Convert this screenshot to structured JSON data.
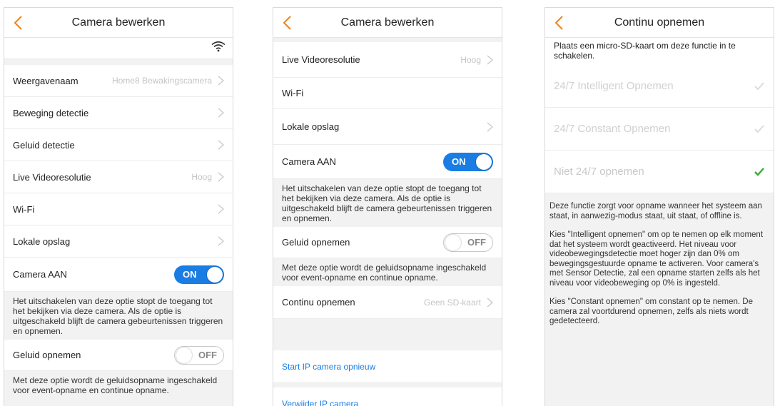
{
  "colors": {
    "accent_orange": "#f0811a",
    "blue": "#1a7de3",
    "check_green": "#3aa83a"
  },
  "screen1": {
    "title": "Camera bewerken",
    "rows": [
      {
        "label": "Weergavenaam",
        "value": "Home8 Bewakingscamera"
      },
      {
        "label": "Beweging detectie",
        "value": ""
      },
      {
        "label": "Geluid detectie",
        "value": ""
      },
      {
        "label": "Live Videoresolutie",
        "value": "Hoog"
      },
      {
        "label": "Wi-Fi",
        "value": ""
      },
      {
        "label": "Lokale opslag",
        "value": ""
      }
    ],
    "camera_on": {
      "label": "Camera AAN",
      "state": "ON"
    },
    "camera_note": "Het uitschakelen van deze optie stopt de toegang tot het bekijken via deze camera. Als de optie is uitgeschakeld blijft de camera gebeurtenissen triggeren en opnemen.",
    "audio": {
      "label": "Geluid opnemen",
      "state": "OFF"
    },
    "audio_note": "Met deze optie wordt de geluidsopname ingeschakeld voor event-opname en continue opname."
  },
  "screen2": {
    "title": "Camera bewerken",
    "rows": [
      {
        "label": "Live Videoresolutie",
        "value": "Hoog"
      },
      {
        "label": "Wi-Fi",
        "value": ""
      },
      {
        "label": "Lokale opslag",
        "value": ""
      }
    ],
    "camera_on": {
      "label": "Camera AAN",
      "state": "ON"
    },
    "camera_note": "Het uitschakelen van deze optie stopt de toegang tot het bekijken via deze camera. Als de optie is uitgeschakeld blijft de camera gebeurtenissen triggeren en opnemen.",
    "audio": {
      "label": "Geluid opnemen",
      "state": "OFF"
    },
    "audio_note": "Met deze optie wordt de geluidsopname ingeschakeld voor event-opname en continue opname.",
    "continu": {
      "label": "Continu opnemen",
      "value": "Geen SD-kaart"
    },
    "restart_link": "Start IP camera opnieuw",
    "delete_link": "Verwijder IP camera"
  },
  "screen3": {
    "title": "Continu opnemen",
    "notice": "Plaats een micro-SD-kaart om deze functie in te schakelen.",
    "options": [
      {
        "label": "24/7 Intelligent Opnemen",
        "selected": false
      },
      {
        "label": "24/7 Constant Opnemen",
        "selected": false
      },
      {
        "label": "Niet 24/7 opnemen",
        "selected": true
      }
    ],
    "paragraphs": [
      "Deze functie zorgt voor opname wanneer het systeem aan staat, in aanwezig-modus staat, uit staat, of offline is.",
      "Kies \"Intelligent opnemen\" om op te nemen op elk moment dat het systeem wordt geactiveerd. Het niveau voor videobewegingsdetectie moet hoger zijn dan 0% om bewegingsgestuurde opname te activeren. Voor camera's met Sensor Detectie, zal een opname starten zelfs als het niveau voor videobeweging op 0% is ingesteld.",
      "Kies \"Constant opnemen\" om constant op te nemen. De camera zal voortdurend opnemen, zelfs als niets wordt gedetecteerd."
    ]
  }
}
